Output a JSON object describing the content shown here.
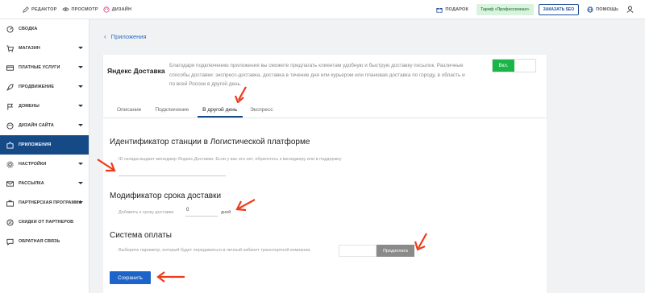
{
  "topbar": {
    "editor": "РЕДАКТОР",
    "preview": "ПРОСМОТР",
    "design": "ДИЗАЙН",
    "gift": "ПОДАРОК",
    "tariff": "Тариф «Профессионал»",
    "seo": "ЗАКАЗАТЬ SEO",
    "help": "ПОМОЩЬ"
  },
  "sidebar": {
    "items": [
      {
        "label": "СВОДКА",
        "icon": "gauge-icon"
      },
      {
        "label": "МАГАЗИН",
        "icon": "cart-icon"
      },
      {
        "label": "ПЛАТНЫЕ УСЛУГИ",
        "icon": "card-icon"
      },
      {
        "label": "ПРОДВИЖЕНИЕ",
        "icon": "rocket-icon"
      },
      {
        "label": "ДОМЕНЫ",
        "icon": "flag-icon"
      },
      {
        "label": "ДИЗАЙН САЙТА",
        "icon": "palette-icon"
      },
      {
        "label": "ПРИЛОЖЕНИЯ",
        "icon": "puzzle-icon"
      },
      {
        "label": "НАСТРОЙКИ",
        "icon": "gear-icon"
      },
      {
        "label": "РАССЫЛКА",
        "icon": "envelope-icon"
      },
      {
        "label": "ПАРТНЕРСКАЯ ПРОГРАММА",
        "icon": "partners-icon"
      },
      {
        "label": "СКИДКИ ОТ ПАРТНЕРОВ",
        "icon": "discount-icon"
      },
      {
        "label": "ОБРАТНАЯ СВЯЗЬ",
        "icon": "chat-icon"
      }
    ],
    "active_index": 6
  },
  "main": {
    "back": "Приложения",
    "card": {
      "logo": "Яндекс Доставка",
      "description": "Благодаря подключению приложения вы сможете предлагать клиентам удобную и быструю доставку посылок. Различные способы доставки: экспресс-доставка, доставка в течение дня или курьером или плановая доставка по городу, в область и по всей России в другой день.",
      "toggle": "Вкл.",
      "tabs": [
        "Описание",
        "Подключение",
        "В другой день",
        "Экспресс"
      ],
      "active_tab": 2
    },
    "station": {
      "title": "Идентификатор станции в Логистической платформе",
      "hint": "ID склада выдает менеджер Яндекс.Доставки. Если у вас его нет, обратитесь к менеджеру или в поддержку",
      "value": ""
    },
    "modifier": {
      "title": "Модификатор срока доставки",
      "label": "Добавить к сроку доставки",
      "value": "0",
      "unit": "дней"
    },
    "payment": {
      "title": "Система оплаты",
      "hint": "Выберите параметр, который будет передаваться в личный кабинет транспортной компании.",
      "option": "Предоплата"
    },
    "save": "Сохранить"
  },
  "colors": {
    "accent": "#154a86",
    "button": "#1c64c9",
    "toggle_on": "#19b547",
    "annotation": "#ee3b1c"
  }
}
